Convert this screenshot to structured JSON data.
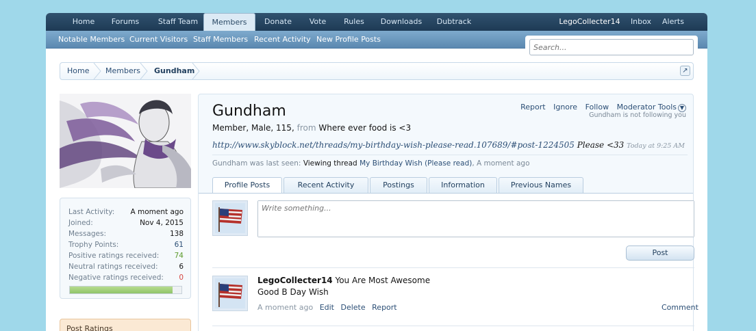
{
  "nav": {
    "tabs": [
      "Home",
      "Forums",
      "Staff Team",
      "Members",
      "Donate",
      "Vote",
      "Rules",
      "Downloads",
      "Dubtrack"
    ],
    "active": "Members",
    "user": "LegoCollecter14",
    "inbox": "Inbox",
    "alerts": "Alerts"
  },
  "subnav": [
    "Notable Members",
    "Current Visitors",
    "Staff Members",
    "Recent Activity",
    "New Profile Posts"
  ],
  "search": {
    "placeholder": "Search..."
  },
  "breadcrumb": [
    "Home",
    "Members",
    "Gundham"
  ],
  "stats": {
    "rows": [
      {
        "label": "Last Activity:",
        "value": "A moment ago"
      },
      {
        "label": "Joined:",
        "value": "Nov 4, 2015"
      },
      {
        "label": "Messages:",
        "value": "138"
      },
      {
        "label": "Trophy Points:",
        "value": "61"
      },
      {
        "label": "Positive ratings received:",
        "value": "74"
      },
      {
        "label": "Neutral ratings received:",
        "value": "6"
      },
      {
        "label": "Negative ratings received:",
        "value": "0"
      }
    ],
    "rating_fill": 0.92,
    "colors": {
      "positive": "#5b9a2b",
      "negative": "#d64541",
      "trophy": "#2b4e75"
    }
  },
  "ratings_box": "Post Ratings",
  "profile": {
    "name": "Gundham",
    "info_prefix": "Member, Male, 115,",
    "info_from": "from",
    "info_location": "Where ever food is <3",
    "status_link": "http://www.skyblock.net/threads/my-birthday-wish-please-read.107689/#post-1224505",
    "status_text": "Please <33",
    "status_time": "Today at 9:25 AM",
    "seen_prefix": "Gundham was last seen:",
    "seen_action": "Viewing thread",
    "seen_thread": "My Birthday Wish (Please read)",
    "seen_time": ", A moment ago",
    "actions": [
      "Report",
      "Ignore",
      "Follow",
      "Moderator Tools"
    ],
    "following": "Gundham is not following you"
  },
  "profile_tabs": [
    "Profile Posts",
    "Recent Activity",
    "Postings",
    "Information",
    "Previous Names"
  ],
  "composer": {
    "placeholder": "Write something...",
    "post_label": "Post"
  },
  "post": {
    "author": "LegoCollecter14",
    "title": "You Are Most Awesome",
    "message": "Good B Day Wish",
    "time": "A moment ago",
    "links": [
      "Edit",
      "Delete",
      "Report"
    ],
    "comment": "Comment"
  }
}
